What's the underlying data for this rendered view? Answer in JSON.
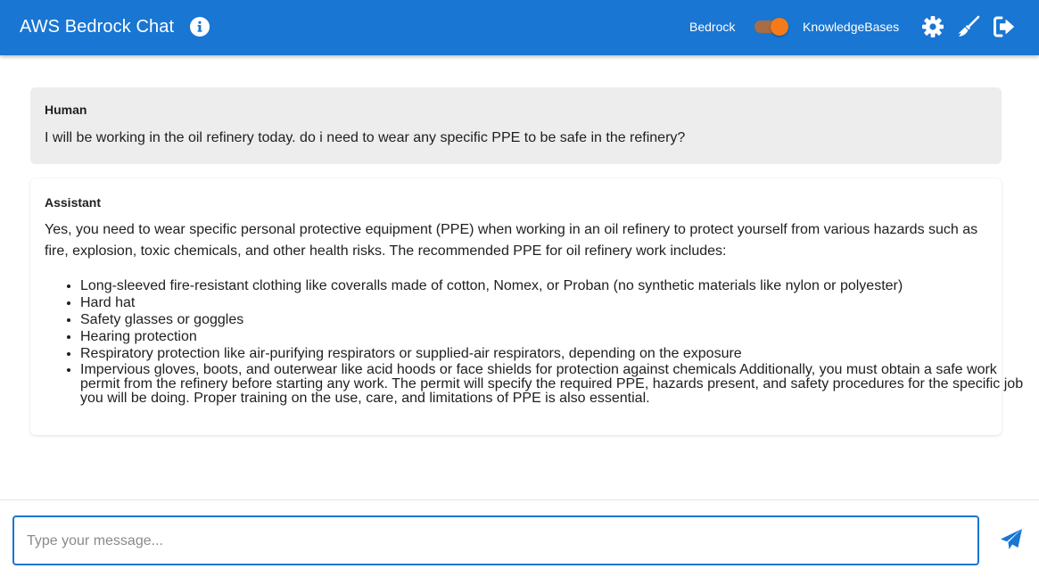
{
  "header": {
    "title": "AWS Bedrock Chat",
    "mode_left_label": "Bedrock",
    "mode_right_label": "KnowledgeBases",
    "knowledge_bases_enabled": true,
    "icons": [
      "info-icon",
      "gear-icon",
      "broom-icon",
      "logout-icon"
    ]
  },
  "colors": {
    "appbar": "#1976d2",
    "switch_thumb": "#f47a1a",
    "switch_track": "#b06d3c",
    "human_bubble": "#ededed",
    "composer_border": "#1976d2"
  },
  "messages": [
    {
      "role": "Human",
      "text": "I will be working in the oil refinery today. do i need to wear any specific PPE to be safe in the refinery?"
    },
    {
      "role": "Assistant",
      "intro": "Yes, you need to wear specific personal protective equipment (PPE) when working in an oil refinery to protect yourself from various hazards such as fire, explosion, toxic chemicals, and other health risks. The recommended PPE for oil refinery work includes:",
      "items": [
        "Long-sleeved fire-resistant clothing like coveralls made of cotton, Nomex, or Proban (no synthetic materials like nylon or polyester)",
        "Hard hat",
        "Safety glasses or goggles",
        "Hearing protection",
        "Respiratory protection like air-purifying respirators or supplied-air respirators, depending on the exposure",
        "Impervious gloves, boots, and outerwear like acid hoods or face shields for protection against chemicals Additionally, you must obtain a safe work permit from the refinery before starting any work. The permit will specify the required PPE, hazards present, and safety procedures for the specific job you will be doing. Proper training on the use, care, and limitations of PPE is also essential."
      ]
    }
  ],
  "composer": {
    "placeholder": "Type your message...",
    "value": "",
    "send_icon": "send-icon"
  }
}
